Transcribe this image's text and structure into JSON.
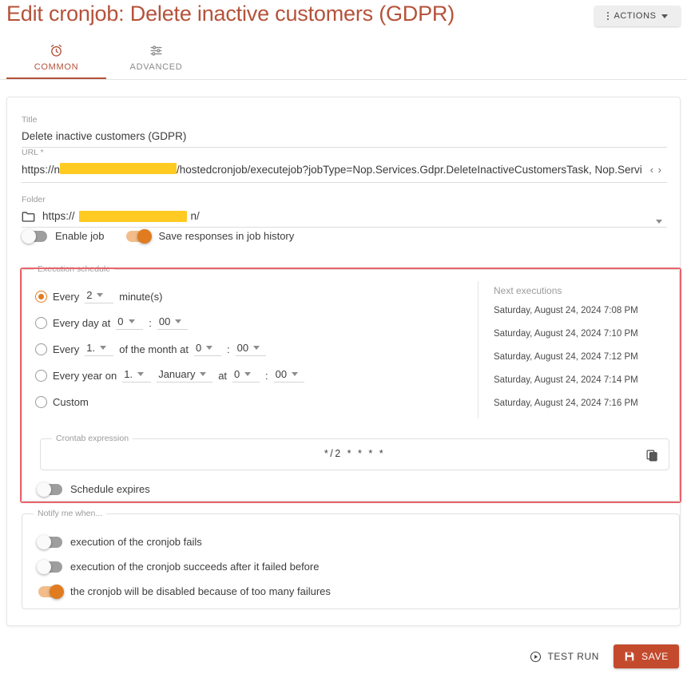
{
  "header": {
    "title": "Edit cronjob: Delete inactive customers (GDPR)",
    "actions_label": "ACTIONS"
  },
  "tabs": [
    {
      "label": "COMMON",
      "icon": "alarm-clock-icon",
      "active": true
    },
    {
      "label": "ADVANCED",
      "icon": "sliders-icon",
      "active": false
    }
  ],
  "form": {
    "title_field": {
      "label": "Title",
      "value": "Delete inactive customers (GDPR)"
    },
    "url_field": {
      "label": "URL *",
      "prefix": "https://n",
      "redacted": "",
      "suffix": "/hostedcronjob/executejob?jobType=Nop.Services.Gdpr.DeleteInactiveCustomersTask, Nop.Servi",
      "nav_glyph": "‹ ›"
    },
    "folder_field": {
      "label": "Folder",
      "prefix": "https://",
      "redacted": "",
      "suffix": "n/"
    },
    "toggles": [
      {
        "label": "Enable job",
        "on": false
      },
      {
        "label": "Save responses in job history",
        "on": true
      }
    ]
  },
  "execution_schedule": {
    "legend": "Execution schedule",
    "options": [
      {
        "id": "every-minutes",
        "selected": true,
        "parts": [
          {
            "type": "text",
            "text": "Every"
          },
          {
            "type": "select",
            "value": "2",
            "name": "minutes-interval-select"
          },
          {
            "type": "text",
            "text": "minute(s)"
          }
        ]
      },
      {
        "id": "every-day",
        "selected": false,
        "parts": [
          {
            "type": "text",
            "text": "Every day at"
          },
          {
            "type": "select",
            "value": "0",
            "name": "daily-hour-select"
          },
          {
            "type": "colon",
            "text": ":"
          },
          {
            "type": "select",
            "value": "00",
            "name": "daily-minute-select"
          }
        ]
      },
      {
        "id": "every-month",
        "selected": false,
        "parts": [
          {
            "type": "text",
            "text": "Every"
          },
          {
            "type": "select",
            "value": "1.",
            "name": "monthly-day-select"
          },
          {
            "type": "text",
            "text": "of the month at"
          },
          {
            "type": "select",
            "value": "0",
            "name": "monthly-hour-select"
          },
          {
            "type": "colon",
            "text": ":"
          },
          {
            "type": "select",
            "value": "00",
            "name": "monthly-minute-select"
          }
        ]
      },
      {
        "id": "every-year",
        "selected": false,
        "parts": [
          {
            "type": "text",
            "text": "Every year on"
          },
          {
            "type": "select",
            "value": "1.",
            "name": "yearly-day-select"
          },
          {
            "type": "select",
            "value": "January",
            "name": "yearly-month-select"
          },
          {
            "type": "text",
            "text": "at"
          },
          {
            "type": "select",
            "value": "0",
            "name": "yearly-hour-select"
          },
          {
            "type": "colon",
            "text": ":"
          },
          {
            "type": "select",
            "value": "00",
            "name": "yearly-minute-select"
          }
        ]
      },
      {
        "id": "custom",
        "selected": false,
        "parts": [
          {
            "type": "text",
            "text": "Custom"
          }
        ]
      }
    ],
    "next_executions": {
      "title": "Next executions",
      "items": [
        "Saturday, August 24, 2024 7:08 PM",
        "Saturday, August 24, 2024 7:10 PM",
        "Saturday, August 24, 2024 7:12 PM",
        "Saturday, August 24, 2024 7:14 PM",
        "Saturday, August 24, 2024 7:16 PM"
      ]
    },
    "crontab": {
      "legend": "Crontab expression",
      "value": "*/2 * * * *",
      "copy_icon": "copy-icon"
    },
    "schedule_expires": {
      "label": "Schedule expires",
      "on": false
    }
  },
  "notify": {
    "legend": "Notify me when...",
    "items": [
      {
        "label": "execution of the cronjob fails",
        "on": false
      },
      {
        "label": "execution of the cronjob succeeds after it failed before",
        "on": false
      },
      {
        "label": "the cronjob will be disabled because of too many failures",
        "on": true
      }
    ]
  },
  "footer": {
    "test_run_label": "TEST RUN",
    "save_label": "SAVE"
  },
  "colors": {
    "accent": "#b5523a",
    "save_button": "#c44a2e",
    "toggle_on": "#e07b20",
    "radio_on": "#e07b20",
    "highlight_border": "#e8636b",
    "redaction": "#ffca21"
  }
}
